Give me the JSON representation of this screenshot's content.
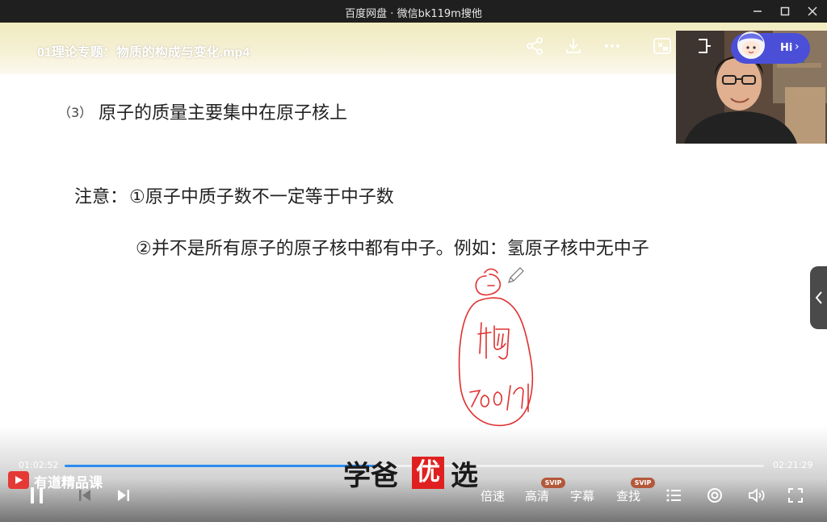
{
  "window": {
    "title": "百度网盘 · 微信bk119m搜他"
  },
  "video": {
    "title": "01理论专题：物质的构成与变化.mp4"
  },
  "slide": {
    "line_number": "（3）",
    "line_text": "原子的质量主要集中在原子核上",
    "note_label": "注意：",
    "note_1": "①原子中质子数不一定等于中子数",
    "note_2": "②并不是所有原子的原子核中都有中子。例如：氢原子核中无中子"
  },
  "webcam": {
    "assistant_label": "Hi",
    "assistant_chevron": "›"
  },
  "player": {
    "current_time": "01:02:52",
    "total_time": "02:21:29",
    "progress": 0.444,
    "brand": "有道精品课",
    "speed_label": "倍速",
    "quality_label": "高清",
    "subtitle_label": "字幕",
    "search_label": "查找",
    "svip_badge": "SVIP",
    "accent_color": "#2d8cf0"
  },
  "watermark": {
    "left": "学爸",
    "middle": "优",
    "right": "选"
  }
}
